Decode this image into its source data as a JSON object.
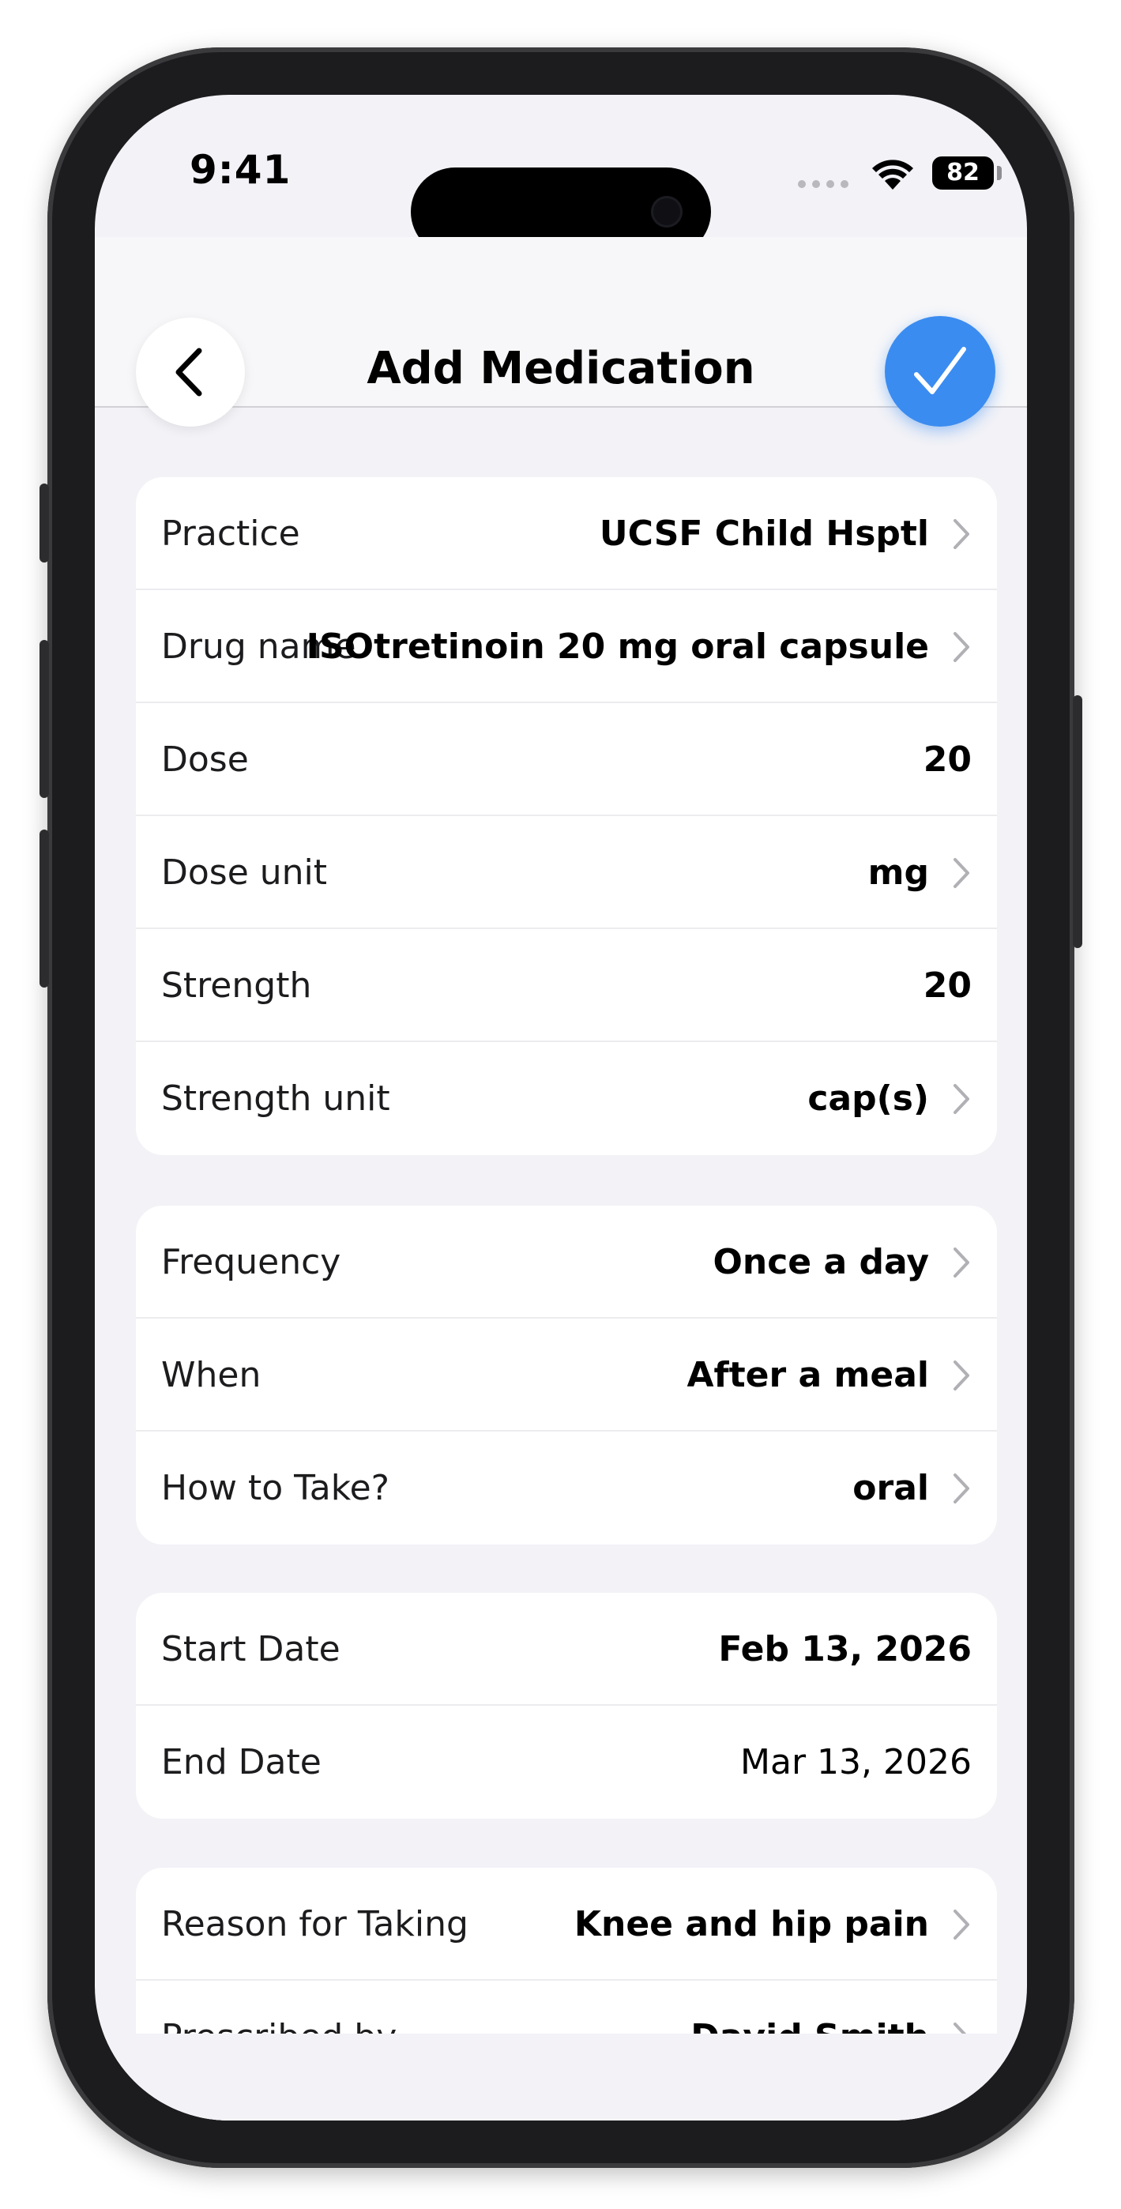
{
  "status": {
    "time": "9:41",
    "battery": "82"
  },
  "nav": {
    "title": "Add Medication"
  },
  "group1": [
    {
      "label": "Practice",
      "value": "UCSF Child Hsptl"
    },
    {
      "label": "Drug name",
      "value": "ISOtretinoin 20 mg oral capsule"
    },
    {
      "label": "Dose",
      "value": "20"
    },
    {
      "label": "Dose unit",
      "value": "mg"
    },
    {
      "label": "Strength",
      "value": "20"
    },
    {
      "label": "Strength unit",
      "value": "cap(s)"
    }
  ],
  "group2": [
    {
      "label": "Frequency",
      "value": "Once a day"
    },
    {
      "label": "When",
      "value": "After a meal"
    },
    {
      "label": "How to Take?",
      "value": "oral"
    }
  ],
  "group3": [
    {
      "label": "Start Date",
      "value": "Feb 13, 2026"
    },
    {
      "label": "End Date",
      "value": "Mar 13, 2026"
    }
  ],
  "group4": [
    {
      "label": "Reason for Taking",
      "value": "Knee and hip pain"
    },
    {
      "label": "Prescribed by",
      "value": "David Smith"
    },
    {
      "label": "",
      "value": ""
    }
  ],
  "colors": {
    "accent": "#3b8cf0",
    "background": "#f2f2f7"
  }
}
